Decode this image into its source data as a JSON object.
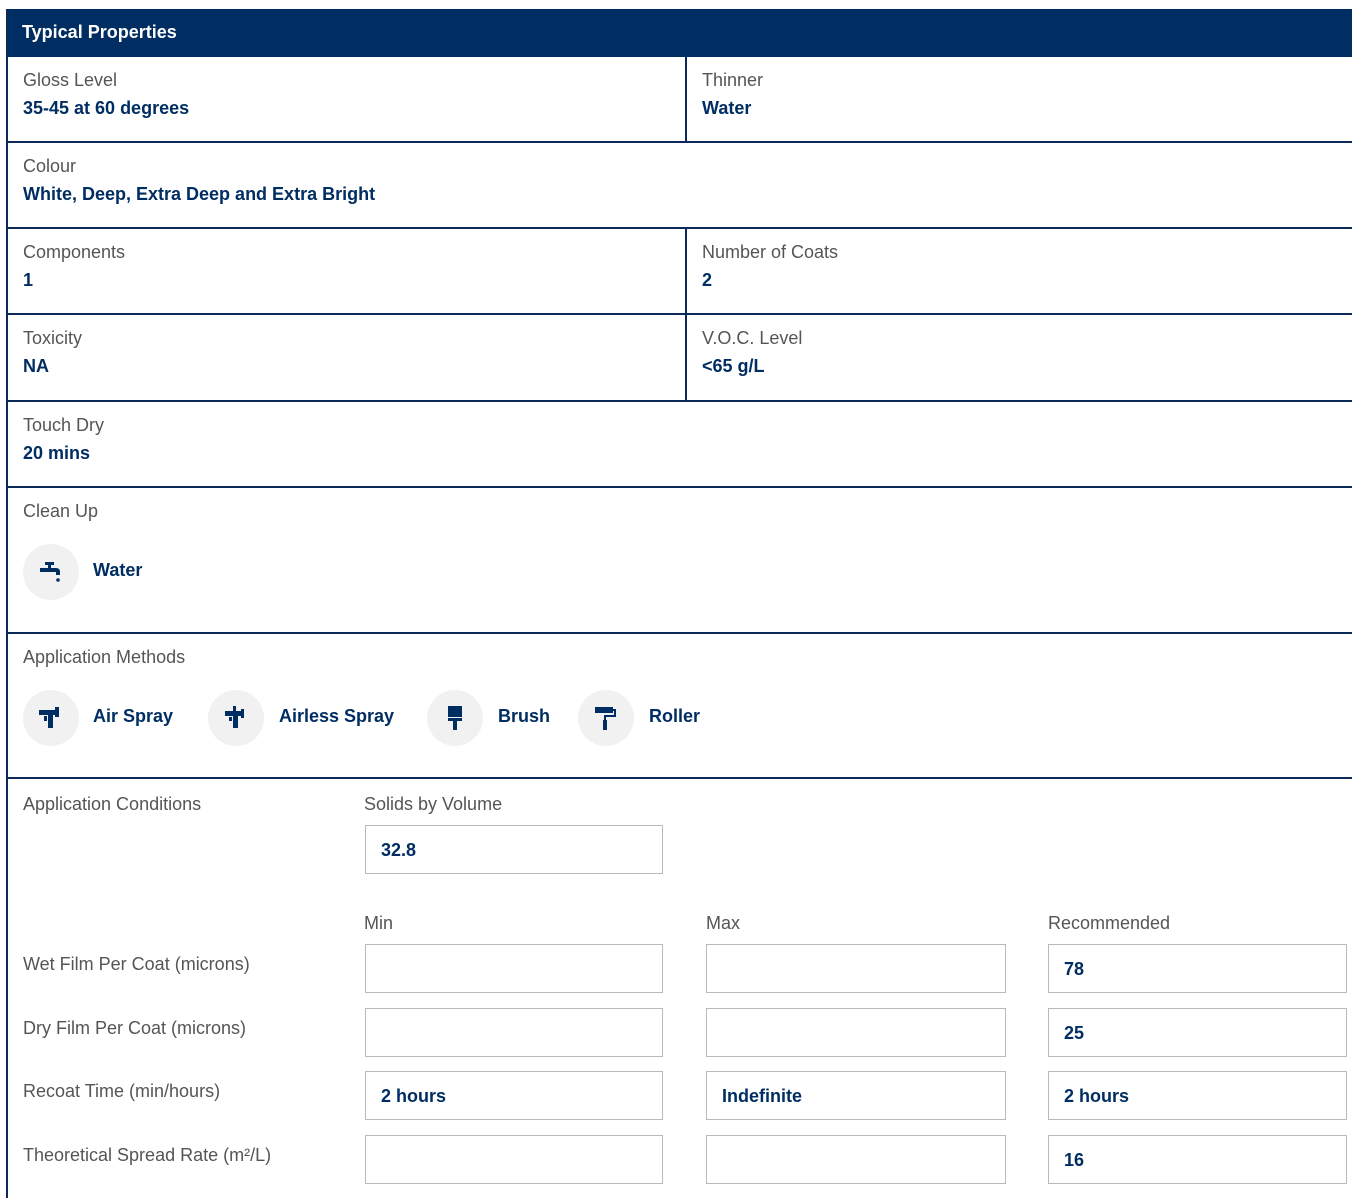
{
  "header": {
    "title": "Typical Properties"
  },
  "properties": {
    "gloss": {
      "label": "Gloss Level",
      "value": "35-45 at 60 degrees"
    },
    "thinner": {
      "label": "Thinner",
      "value": "Water"
    },
    "colour": {
      "label": "Colour",
      "value": "White, Deep, Extra Deep and Extra Bright"
    },
    "components": {
      "label": "Components",
      "value": "1"
    },
    "coats": {
      "label": "Number of Coats",
      "value": "2"
    },
    "toxicity": {
      "label": "Toxicity",
      "value": "NA"
    },
    "voc": {
      "label": "V.O.C. Level",
      "value": "<65 g/L"
    },
    "touch_dry": {
      "label": "Touch Dry",
      "value": "20 mins"
    }
  },
  "clean_up": {
    "label": "Clean Up",
    "items": [
      {
        "icon": "tap-icon",
        "label": "Water"
      }
    ]
  },
  "application_methods": {
    "label": "Application Methods",
    "items": [
      {
        "icon": "air-spray-icon",
        "label": "Air Spray"
      },
      {
        "icon": "airless-spray-icon",
        "label": "Airless Spray"
      },
      {
        "icon": "brush-icon",
        "label": "Brush"
      },
      {
        "icon": "roller-icon",
        "label": "Roller"
      }
    ]
  },
  "application_conditions": {
    "label": "Application Conditions",
    "solids_label": "Solids by Volume",
    "solids_value": "32.8",
    "columns": [
      "Min",
      "Max",
      "Recommended"
    ],
    "rows": [
      {
        "label": "Wet Film Per Coat (microns)",
        "min": "",
        "max": "",
        "recommended": "78"
      },
      {
        "label": "Dry Film Per Coat (microns)",
        "min": "",
        "max": "",
        "recommended": "25"
      },
      {
        "label": "Recoat Time (min/hours)",
        "min": "2 hours",
        "max": "Indefinite",
        "recommended": "2 hours"
      },
      {
        "label": "Theoretical Spread Rate (m²/L)",
        "min": "",
        "max": "",
        "recommended": "16"
      }
    ]
  },
  "colors": {
    "brand_navy": "#002d62",
    "icon_bg": "#f1f1f1",
    "label_gray": "#555555"
  }
}
